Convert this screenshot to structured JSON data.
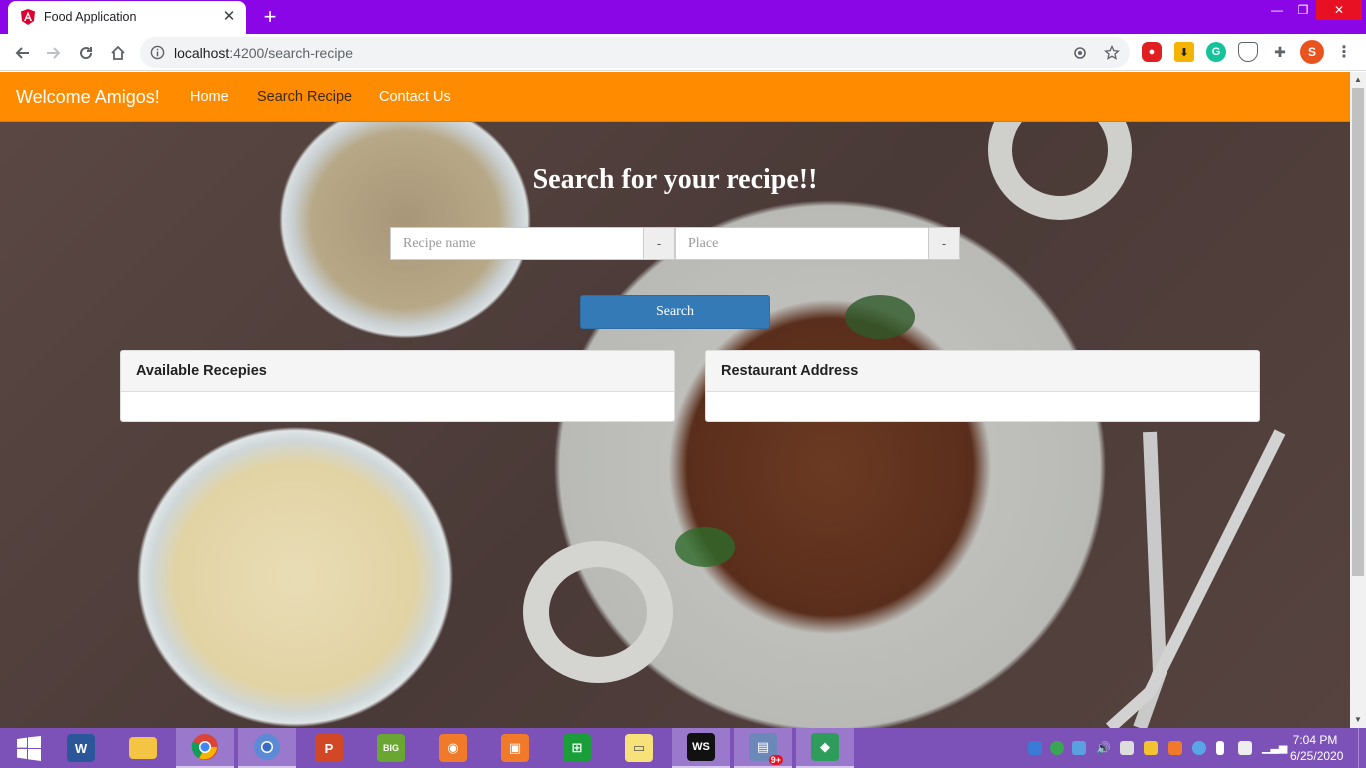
{
  "browser": {
    "tab_title": "Food Application",
    "url_host": "localhost",
    "url_path": ":4200/search-recipe",
    "profile_initial": "S"
  },
  "navbar": {
    "brand": "Welcome Amigos!",
    "links": [
      {
        "label": "Home"
      },
      {
        "label": "Search Recipe"
      },
      {
        "label": "Contact Us"
      }
    ]
  },
  "search": {
    "heading": "Search for your recipe!!",
    "recipe_placeholder": "Recipe name",
    "place_placeholder": "Place",
    "addon_label": "-",
    "button_label": "Search"
  },
  "panels": {
    "recipes_heading": "Available Recepies",
    "address_heading": "Restaurant Address"
  },
  "taskbar": {
    "time": "7:04 PM",
    "date": "6/25/2020",
    "store_badge": "9+"
  },
  "colors": {
    "chrome_frame": "#8a06e6",
    "navbar": "#ff8c00",
    "primary_button": "#337ab7",
    "taskbar": "#7d52b8"
  }
}
